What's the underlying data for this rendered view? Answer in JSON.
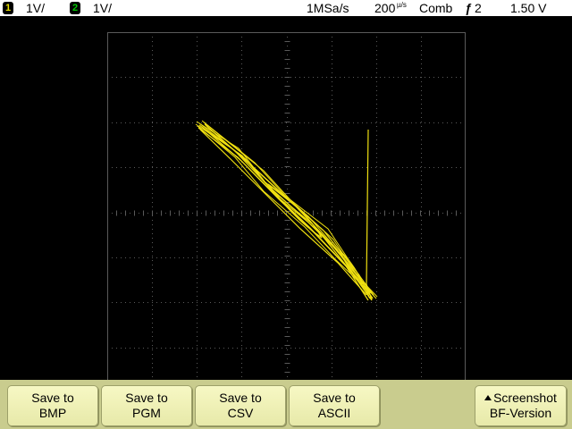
{
  "status": {
    "ch1_number": "1",
    "ch1_scale": "1V/",
    "ch2_number": "2",
    "ch2_scale": "1V/",
    "sample_rate": "1MSa/s",
    "timebase_value": "200",
    "timebase_unit": "µ/s",
    "acq_mode": "Comb",
    "trigger_label": "2",
    "trigger_level": "1.50 V"
  },
  "colors": {
    "trace": "#f0e010",
    "grid": "#5a5a5a",
    "ch1": "#e8e000",
    "ch2": "#00c800",
    "softkey_bar": "#c9cc8e"
  },
  "softkeys": [
    {
      "line1": "Save to",
      "line2": "BMP"
    },
    {
      "line1": "Save to",
      "line2": "PGM"
    },
    {
      "line1": "Save to",
      "line2": "CSV"
    },
    {
      "line1": "Save to",
      "line2": "ASCII"
    },
    {
      "line1": "Screenshot",
      "line2": "BF-Version"
    }
  ]
}
